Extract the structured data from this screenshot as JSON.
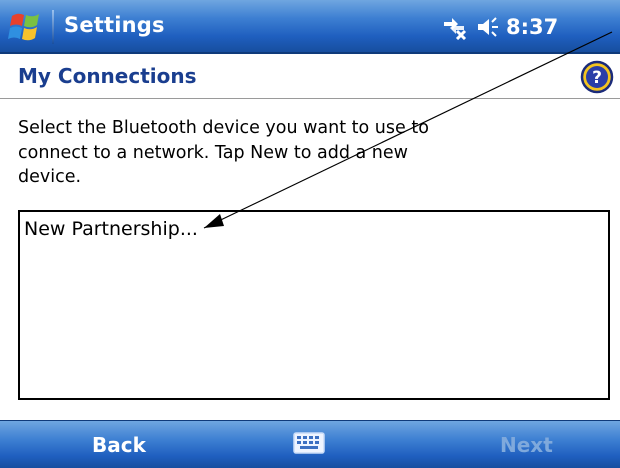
{
  "titlebar": {
    "title": "Settings",
    "time": "8:37",
    "icons": [
      "windows-start-icon",
      "connectivity-icon",
      "volume-icon"
    ]
  },
  "header": {
    "title": "My Connections",
    "help_icon": "help-icon"
  },
  "main": {
    "description": "Select the Bluetooth device you want to use to connect to a network. Tap New to add a new device.",
    "list_items": [
      "New Partnership..."
    ]
  },
  "softkeys": {
    "left": "Back",
    "right": "Next",
    "center_icon": "keyboard-icon"
  },
  "colors": {
    "titlebar": "#1f5fbf",
    "header_text": "#1a3e8f",
    "disabled_softkey": "#7fa9dc"
  }
}
